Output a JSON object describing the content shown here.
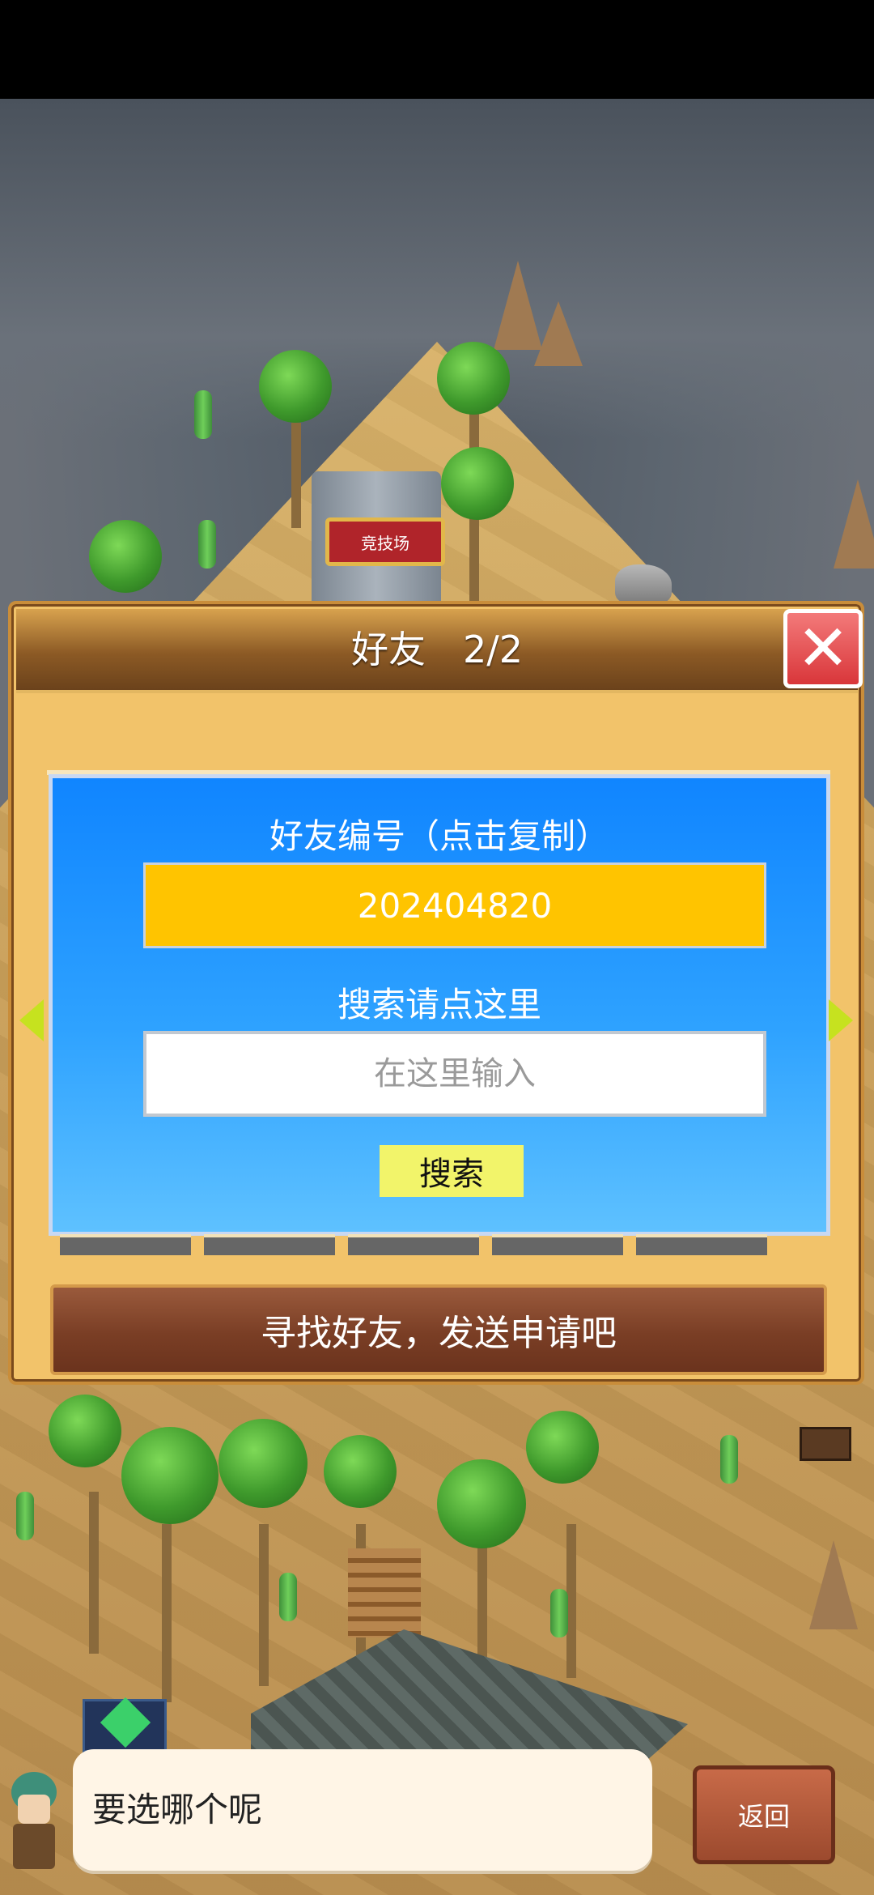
{
  "map": {
    "arena_sign": "竞技场"
  },
  "friends_dialog": {
    "title": "好友　2/2",
    "close_icon": "close-icon",
    "friend_id_label": "好友编号（点击复制）",
    "friend_id_value": "202404820",
    "search_label": "搜索请点这里",
    "search_placeholder": "在这里输入",
    "search_button": "搜索",
    "find_friends_button": "寻找好友，发送申请吧"
  },
  "bottom": {
    "speech_text": "要选哪个呢",
    "back_button": "返回",
    "avatar_icon": "character-avatar-icon",
    "gem_icon": "gem-icon"
  },
  "colors": {
    "panel_blue": "#1085ff",
    "id_field": "#ffc400",
    "close_red": "#d9363a",
    "search_button": "#f2f46a"
  }
}
